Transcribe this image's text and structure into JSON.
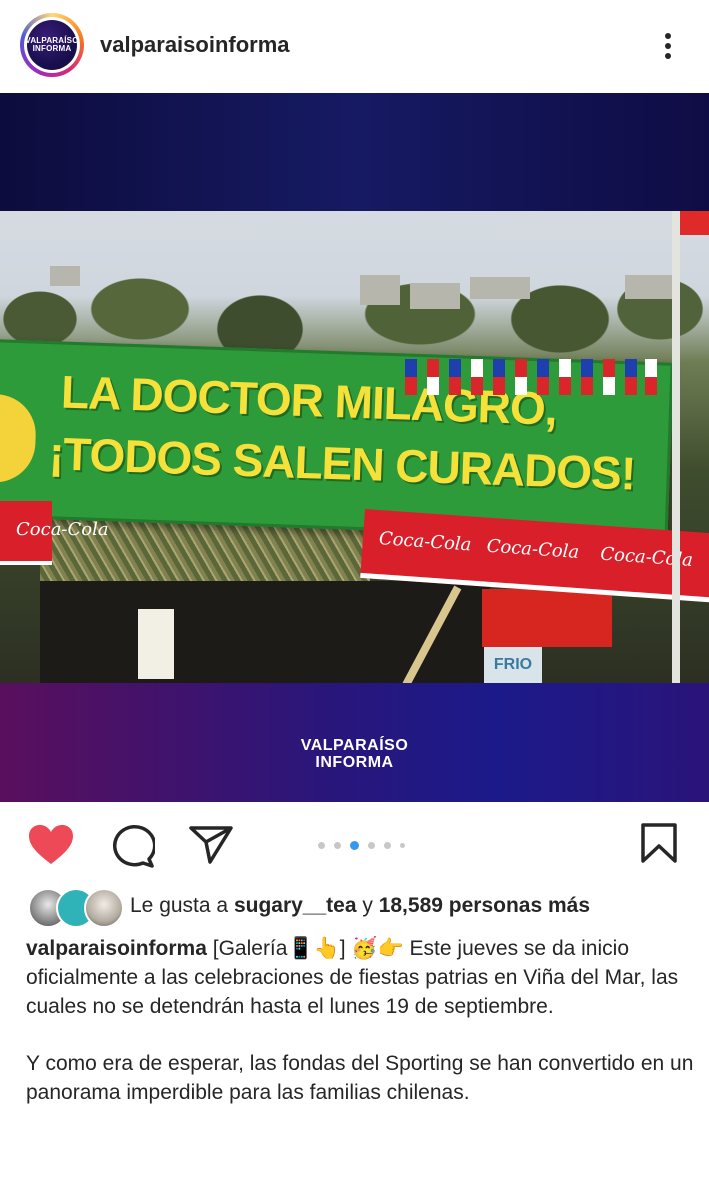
{
  "header": {
    "username": "valparaisoinforma",
    "avatar_text_line1": "VALPARAÍSO",
    "avatar_text_line2": "INFORMA"
  },
  "post_image": {
    "banner_line1": "LA DOCTOR MILAGRO,",
    "banner_line2": "¡TODOS SALEN CURADOS!",
    "awning_text": "Coca-Cola",
    "frio_sign": "FRIO",
    "brand_line1": "VALPARAÍSO",
    "brand_line2": "INFORMA"
  },
  "carousel": {
    "count": 6,
    "active_index": 2
  },
  "icons": {
    "like": "heart-icon",
    "comment": "comment-icon",
    "share": "share-icon",
    "save": "bookmark-icon",
    "more": "more-vertical-icon"
  },
  "colors": {
    "like_red": "#ed4956",
    "carousel_active": "#3897f0",
    "text": "#262626"
  },
  "likes": {
    "prefix": "Le gusta a",
    "user": "sugary__tea",
    "connector": "y",
    "others": "18,589 personas más"
  },
  "caption": {
    "username": "valparaisoinforma",
    "paragraph1": "[Galería📱👆] 🥳👉 Este jueves se da inicio oficialmente a las celebraciones de fiestas patrias en Viña del Mar, las cuales no se detendrán hasta el lunes 19 de septiembre.",
    "paragraph2": "Y como era de esperar, las fondas del Sporting se han convertido en un panorama imperdible para las familias chilenas."
  }
}
